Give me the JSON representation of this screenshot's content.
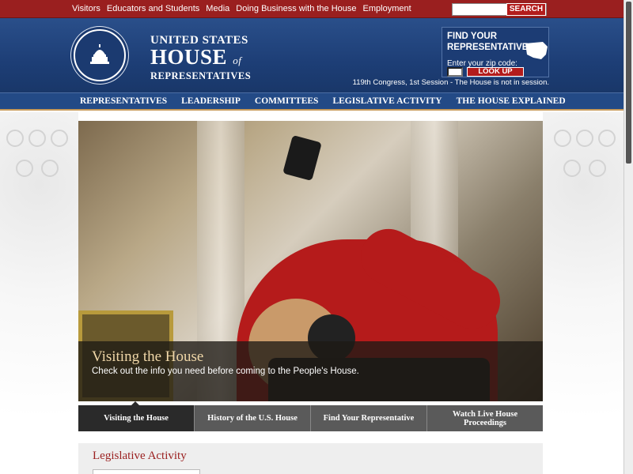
{
  "utility": {
    "links": [
      "Visitors",
      "Educators and Students",
      "Media",
      "Doing Business with the House",
      "Employment"
    ],
    "search_button": "SEARCH",
    "search_placeholder": ""
  },
  "brand": {
    "line1": "UNITED STATES",
    "line2": "HOUSE",
    "line2_of": "of",
    "line3": "REPRESENTATIVES"
  },
  "find_rep": {
    "title": "FIND YOUR REPRESENTATIVE",
    "zip_label": "Enter your zip code:",
    "lookup_button": "LOOK UP"
  },
  "session_text": "119th Congress, 1st Session - The House is not in session.",
  "main_nav": [
    "REPRESENTATIVES",
    "LEADERSHIP",
    "COMMITTEES",
    "LEGISLATIVE ACTIVITY",
    "THE HOUSE EXPLAINED"
  ],
  "hero": {
    "title": "Visiting the House",
    "subtitle": "Check out the info you need before coming to the People's House."
  },
  "slider_tabs": [
    "Visiting the House",
    "History of the U.S. House",
    "Find Your Representative",
    "Watch Live House Proceedings"
  ],
  "legislative": {
    "title": "Legislative Activity"
  },
  "colors": {
    "utility_red": "#9a1f1f",
    "header_blue": "#1d3e76",
    "accent_gold": "#c89a5a"
  }
}
